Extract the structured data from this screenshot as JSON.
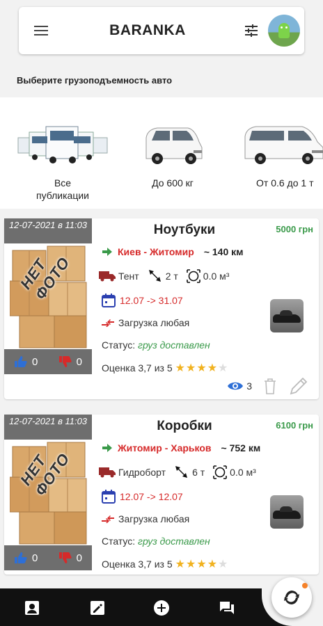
{
  "header": {
    "title": "BARANKA"
  },
  "capacity": {
    "title": "Выберите грузоподъемность авто",
    "options": [
      {
        "label": "Все публикации"
      },
      {
        "label": "До 600 кг"
      },
      {
        "label": "От 0.6 до 1 т"
      }
    ]
  },
  "cards": [
    {
      "date": "12-07-2021 в 11:03",
      "no_photo": "НЕТ ФОТО",
      "likes": "0",
      "dislikes": "0",
      "title": "Ноутбуки",
      "price": "5000 грн",
      "route": "Киев - Житомир",
      "distance": "~ 140 км",
      "body_type": "Тент",
      "tonnage": "2 т",
      "volume": "0.0 м³",
      "dates": "12.07 -> 31.07",
      "loading": "Загрузка любая",
      "status_label": "Статус:",
      "status_value": "груз доставлен",
      "rating_text": "Оценка 3,7 из 5",
      "rating_value": 3.7,
      "views": "3"
    },
    {
      "date": "12-07-2021 в 11:03",
      "no_photo": "НЕТ ФОТО",
      "likes": "0",
      "dislikes": "0",
      "title": "Коробки",
      "price": "6100 грн",
      "route": "Житомир - Харьков",
      "distance": "~ 752 км",
      "body_type": "Гидроборт",
      "tonnage": "6 т",
      "volume": "0.0 м³",
      "dates": "12.07 -> 12.07",
      "loading": "Загрузка любая",
      "status_label": "Статус:",
      "status_value": "груз доставлен",
      "rating_text": "Оценка 3,7 из 5",
      "rating_value": 3.7
    }
  ],
  "colors": {
    "route": "#d62a2a",
    "price": "#3a9a4a",
    "accent_blue": "#2e6fd6",
    "dislike": "#d62a2a",
    "fab_dot": "#f5822a"
  }
}
